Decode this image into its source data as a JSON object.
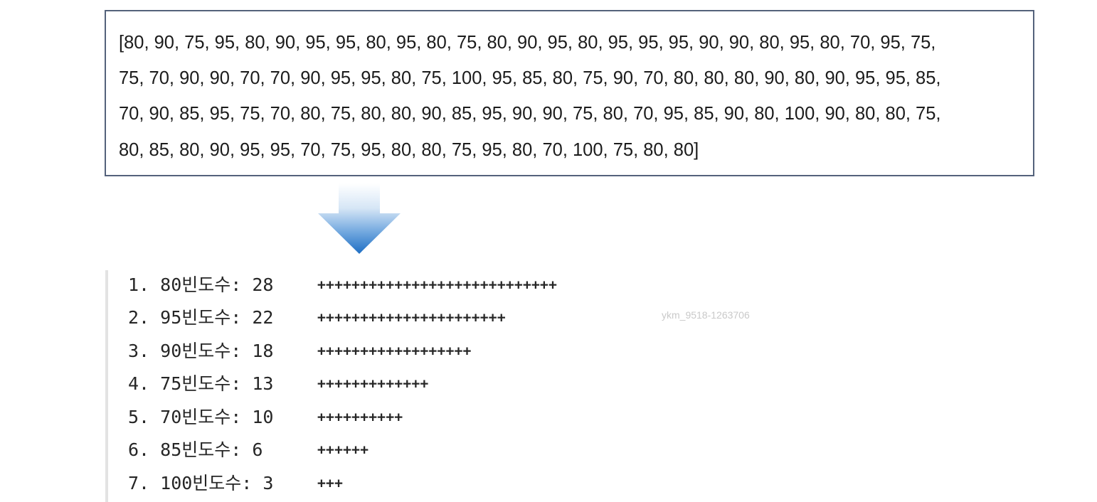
{
  "data_list": {
    "lines": [
      "[80, 90, 75, 95, 80, 90, 95, 95, 80, 95, 80, 75, 80, 90, 95, 80, 95, 95, 95, 90, 90, 80, 95, 80, 70, 95, 75,",
      "75, 70, 90, 90, 70, 70, 90, 95, 95, 80, 75, 100, 95, 85, 80, 75, 90, 70, 80, 80, 80, 90, 80, 90, 95, 95, 85,",
      "70, 90, 85, 95, 75, 70, 80, 75, 80, 80, 90, 85, 95, 90, 90, 75, 80, 70, 95, 85, 90, 80, 100, 90, 80, 80, 75,",
      "80, 85, 80, 90, 95, 95, 70, 75, 95, 80, 80, 75, 95, 80, 70, 100, 75, 80, 80]"
    ]
  },
  "arrow": {
    "icon": "down-arrow-icon",
    "color_top": "#ffffff",
    "color_bottom": "#1f6fc4"
  },
  "output": {
    "rows": [
      {
        "label": "1. 80빈도수: 28",
        "bar": "++++++++++++++++++++++++++++",
        "count": 28
      },
      {
        "label": "2. 95빈도수: 22",
        "bar": "++++++++++++++++++++++",
        "count": 22
      },
      {
        "label": "3. 90빈도수: 18",
        "bar": "++++++++++++++++++",
        "count": 18
      },
      {
        "label": "4. 75빈도수: 13",
        "bar": "+++++++++++++",
        "count": 13
      },
      {
        "label": "5. 70빈도수: 10",
        "bar": "++++++++++",
        "count": 10
      },
      {
        "label": "6. 85빈도수: 6",
        "bar": "++++++",
        "count": 6
      },
      {
        "label": "7. 100빈도수: 3",
        "bar": "+++",
        "count": 3
      }
    ]
  },
  "watermark": {
    "text": "ykm_9518-1263706"
  }
}
